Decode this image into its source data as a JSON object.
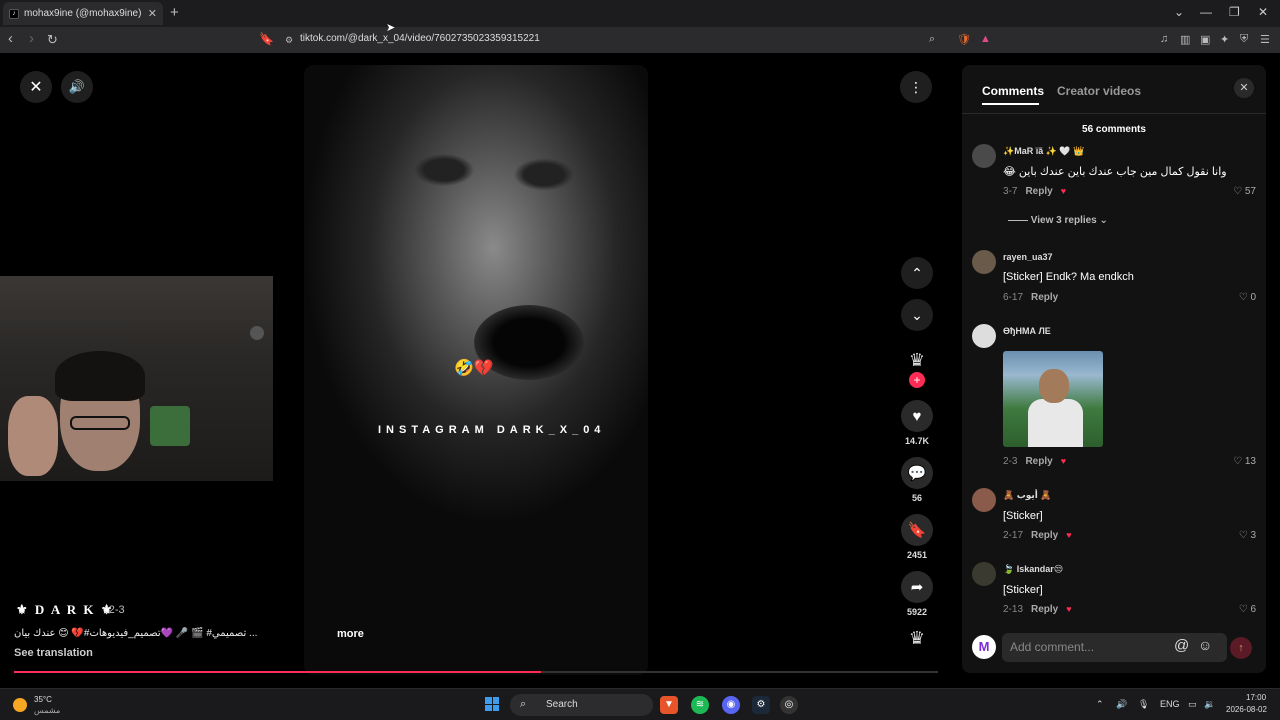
{
  "browser": {
    "tab_title": "mohax9ine (@mohax9ine) | T",
    "tab_favicon": "tiktok-icon",
    "url": "tiktok.com/@dark_x_04/video/7602735023359315221"
  },
  "video": {
    "overlay_emoji": "🤣💔",
    "watermark": "INSTAGRAM DARK_X_04",
    "author": "⚜ D A R K ⚜",
    "date": "· 2-3",
    "caption": "... تصميمي# 🎬 🎤 💜تصميم_فيديوهات#💔 😊 عندك بيان",
    "more_label": "more",
    "see_translation": "See translation",
    "progress_fraction": 0.57
  },
  "actions": {
    "likes": "14.7K",
    "comments": "56",
    "saves": "2451",
    "shares": "5922"
  },
  "panel": {
    "tab_comments": "Comments",
    "tab_creator": "Creator videos",
    "comment_count": "56 comments",
    "view_replies": "View 3 replies",
    "input_placeholder": "Add comment...",
    "reply_label": "Reply",
    "comments": [
      {
        "name": "✨MaR ïã ✨ 🤍 👑",
        "text": "وانا نقول كمال مين جاب عندك باين عندك باين 😂",
        "date": "3-7",
        "likes": "57"
      },
      {
        "name": "rayen_ua37",
        "text": "[Sticker] Endk? Ma endkch",
        "date": "6-17",
        "likes": "0"
      },
      {
        "name": "ϴђΗΜΑ ЛЕ",
        "text": "",
        "date": "2-3",
        "likes": "13"
      },
      {
        "name": "🧸 أيوب 🧸",
        "text": "[Sticker]",
        "date": "2-17",
        "likes": "3"
      },
      {
        "name": "🍃 Iskandar😒",
        "text": "[Sticker]",
        "date": "2-13",
        "likes": "6"
      }
    ]
  },
  "taskbar": {
    "weather_temp": "35°C",
    "weather_desc": "مشمس",
    "search_label": "Search",
    "lang": "ENG",
    "time": "17:00",
    "date": "2026-08-02"
  },
  "colors": {
    "accent": "#fe2c55",
    "panel_bg": "#121212",
    "save_active": "#f5c518"
  }
}
